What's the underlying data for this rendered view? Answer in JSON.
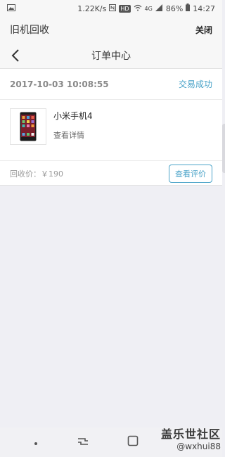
{
  "status_bar": {
    "speed": "1.22K/s",
    "hd": "HD",
    "network": "4G",
    "battery": "86%",
    "time": "14:27"
  },
  "app_bar": {
    "title": "旧机回收",
    "close_label": "关闭"
  },
  "nav_bar": {
    "title": "订单中心"
  },
  "order": {
    "datetime": "2017-10-03 10:08:55",
    "status": "交易成功",
    "product_name": "小米手机4",
    "detail_link": "查看详情",
    "price_label": "回收价：￥190",
    "review_button": "查看评价"
  },
  "watermark": {
    "title": "盖乐世社区",
    "user": "@wxhui88"
  }
}
